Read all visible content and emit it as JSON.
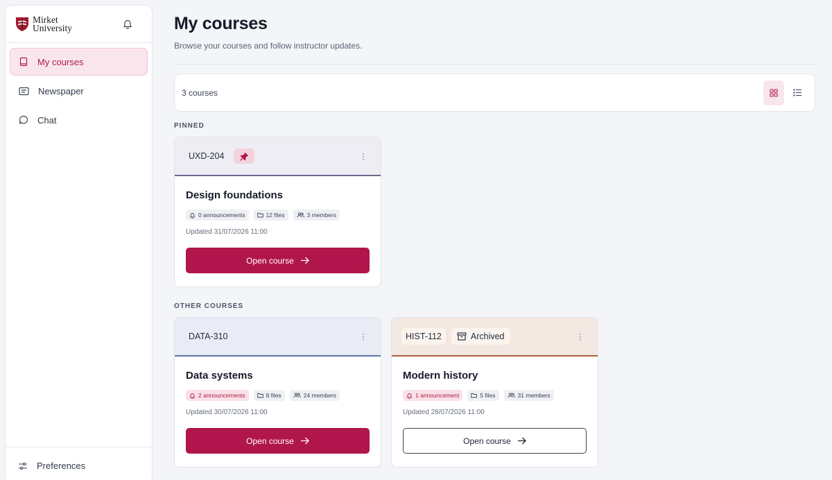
{
  "app": {
    "logo_line1": "Mirket",
    "logo_line2": "University",
    "brand_color": "#b0164b"
  },
  "sidebar": {
    "items": [
      {
        "label": "My courses",
        "icon": "book-icon",
        "active": true
      },
      {
        "label": "Newspaper",
        "icon": "newspaper-icon",
        "active": false
      },
      {
        "label": "Chat",
        "icon": "chat-bubble-icon",
        "active": false
      }
    ],
    "footer_label": "Preferences"
  },
  "header": {
    "title": "My courses",
    "subtitle": "Browse your courses and follow instructor updates."
  },
  "toolbar": {
    "count": "3 courses",
    "view_mode": "grid"
  },
  "sections": {
    "pinned": "PINNED",
    "other": "OTHER COURSES"
  },
  "courses": [
    {
      "code": "UXD-204",
      "pinned": true,
      "archived": false,
      "title": "Design foundations",
      "announcements": "0 announcements",
      "files": "12 files",
      "members": "3 members",
      "updated": "Updated 31/07/2026 11:00",
      "button": "Open course"
    },
    {
      "code": "DATA-310",
      "pinned": false,
      "archived": false,
      "title": "Data systems",
      "announcements": "2 announcements",
      "files": "8 files",
      "members": "24 members",
      "updated": "Updated 30/07/2026 11:00",
      "button": "Open course"
    },
    {
      "code": "HIST-112",
      "pinned": false,
      "archived": true,
      "archived_label": "Archived",
      "title": "Modern history",
      "announcements": "1 announcement",
      "files": "5 files",
      "members": "31 members",
      "updated": "Updated 28/07/2026 11:00",
      "button": "Open course"
    }
  ]
}
